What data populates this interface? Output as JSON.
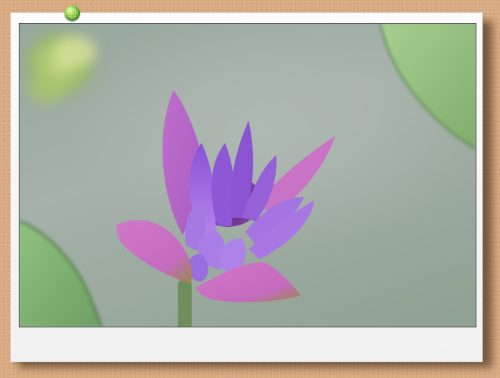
{
  "scene": {
    "subject": "water-lily-bud",
    "colors": {
      "background_frame": "#d9aa80",
      "card": "#f5f5f5",
      "petal_primary": "#9a5fd8",
      "petal_outer": "#c270c8",
      "water": "#9fada4",
      "lily_pad": "#8fbf7a",
      "pin": "#6cbf2a"
    }
  },
  "icons": {
    "pin": "push-pin-icon"
  }
}
